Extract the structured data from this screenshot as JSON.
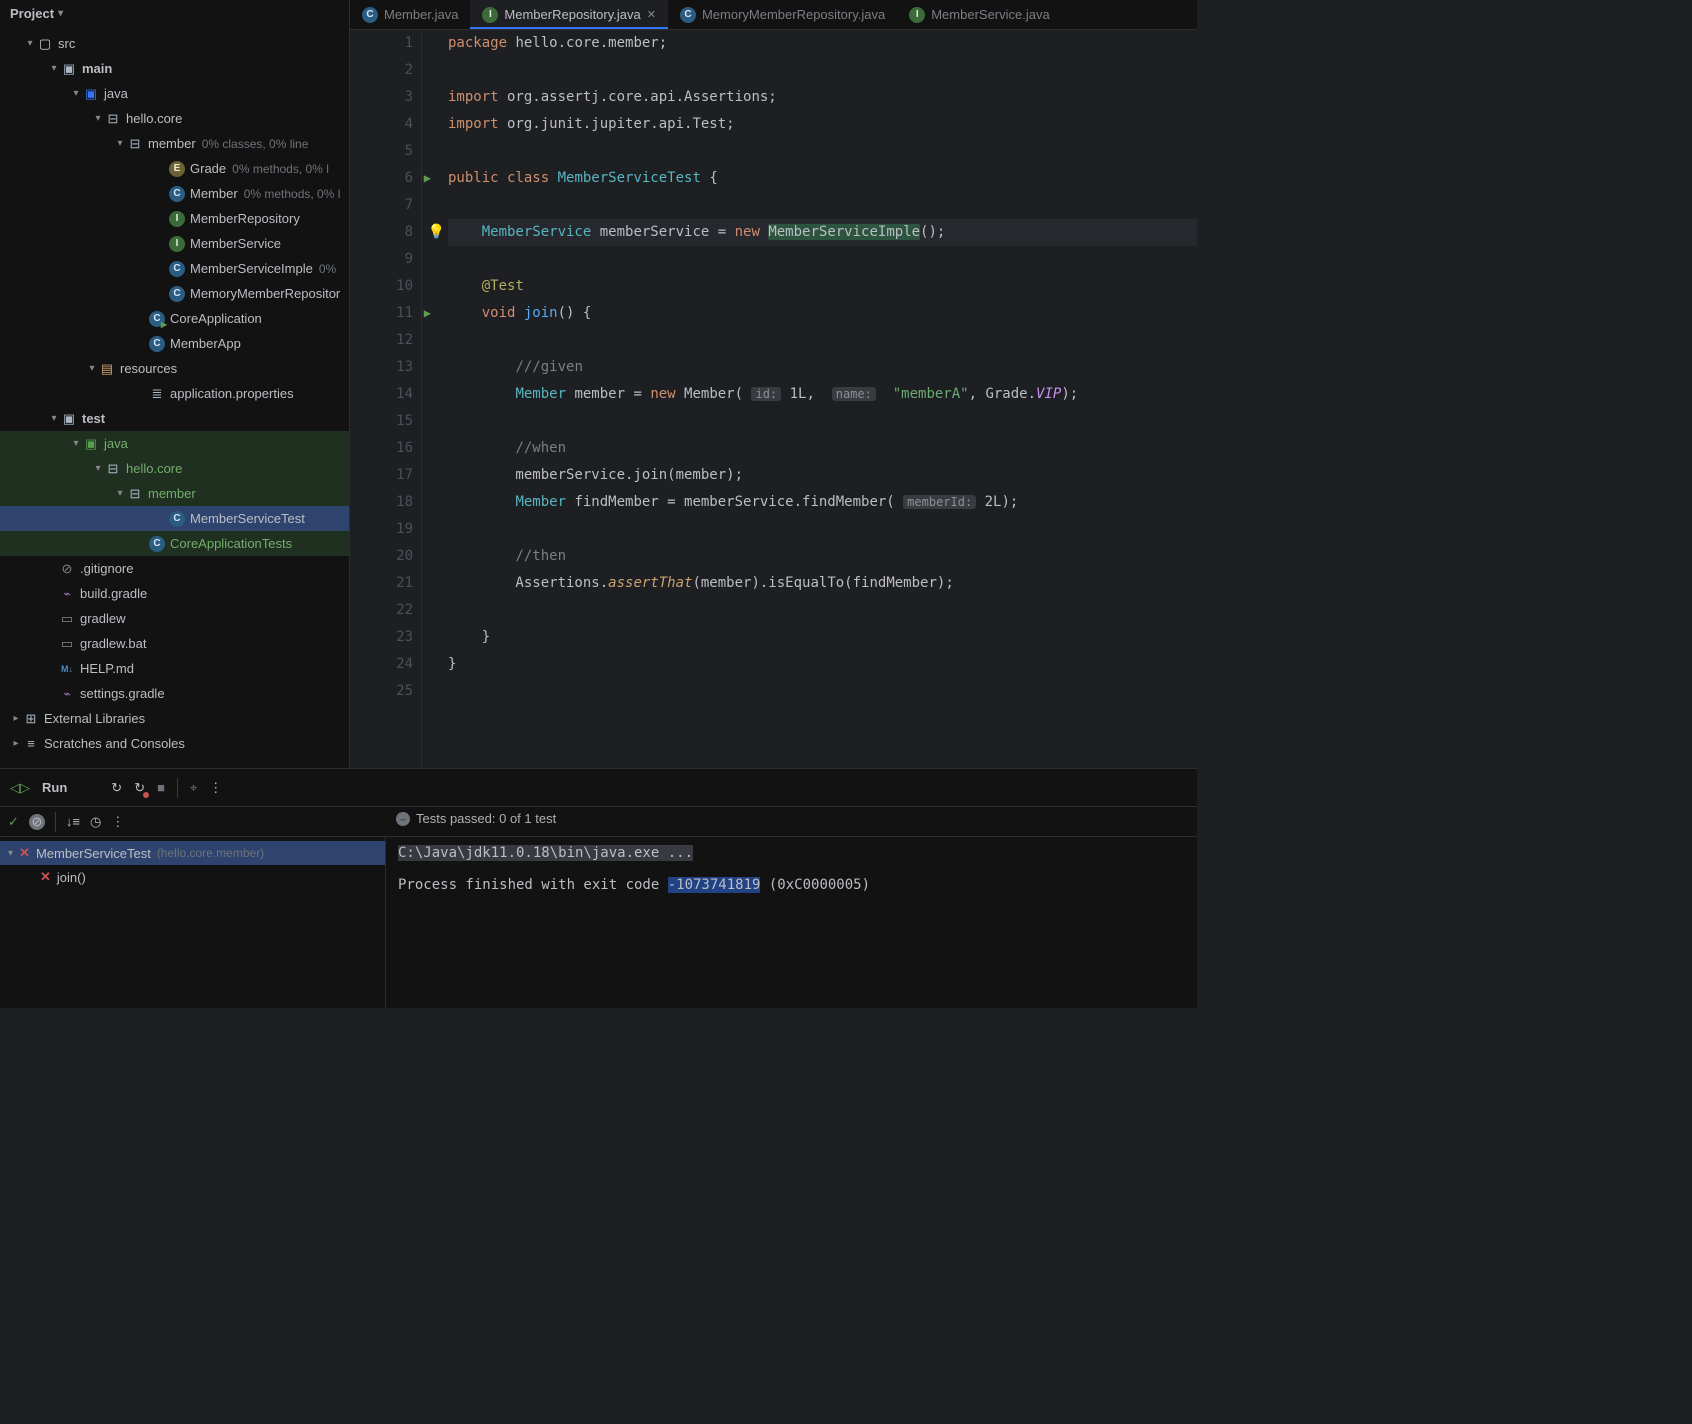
{
  "project": {
    "header": "Project",
    "tree": [
      {
        "indent": 24,
        "arrow": "▾",
        "iconType": "folder",
        "label": "src",
        "name": "folder-src"
      },
      {
        "indent": 48,
        "arrow": "▾",
        "iconType": "module",
        "label": "main",
        "bold": true,
        "name": "folder-main"
      },
      {
        "indent": 70,
        "arrow": "▾",
        "iconType": "folder-blue",
        "label": "java",
        "name": "folder-java-main"
      },
      {
        "indent": 92,
        "arrow": "▾",
        "iconType": "package",
        "label": "hello.core",
        "name": "package-hello-core-main"
      },
      {
        "indent": 114,
        "arrow": "▾",
        "iconType": "package",
        "label": "member",
        "hint": "0% classes, 0% line",
        "name": "package-member-main"
      },
      {
        "indent": 156,
        "arrow": "",
        "iconType": "enum",
        "label": "Grade",
        "hint": "0% methods, 0% l",
        "name": "file-grade"
      },
      {
        "indent": 156,
        "arrow": "",
        "iconType": "class",
        "label": "Member",
        "hint": "0% methods, 0% l",
        "name": "file-member"
      },
      {
        "indent": 156,
        "arrow": "",
        "iconType": "interface",
        "label": "MemberRepository",
        "name": "file-member-repository"
      },
      {
        "indent": 156,
        "arrow": "",
        "iconType": "interface",
        "label": "MemberService",
        "name": "file-member-service"
      },
      {
        "indent": 156,
        "arrow": "",
        "iconType": "class",
        "label": "MemberServiceImple",
        "hint": "0%",
        "name": "file-member-service-imple"
      },
      {
        "indent": 156,
        "arrow": "",
        "iconType": "class",
        "label": "MemoryMemberRepositor",
        "name": "file-memory-member-repository"
      },
      {
        "indent": 136,
        "arrow": "",
        "iconType": "class-run",
        "label": "CoreApplication",
        "name": "file-core-application"
      },
      {
        "indent": 136,
        "arrow": "",
        "iconType": "class",
        "label": "MemberApp",
        "name": "file-member-app"
      },
      {
        "indent": 86,
        "arrow": "▾",
        "iconType": "resources",
        "label": "resources",
        "name": "folder-resources"
      },
      {
        "indent": 136,
        "arrow": "",
        "iconType": "props",
        "label": "application.properties",
        "name": "file-application-properties"
      },
      {
        "indent": 48,
        "arrow": "▾",
        "iconType": "module",
        "label": "test",
        "bold": true,
        "name": "folder-test"
      },
      {
        "indent": 70,
        "arrow": "▾",
        "iconType": "folder-green",
        "label": "java",
        "green": true,
        "name": "folder-java-test"
      },
      {
        "indent": 92,
        "arrow": "▾",
        "iconType": "package",
        "label": "hello.core",
        "green": true,
        "name": "package-hello-core-test"
      },
      {
        "indent": 114,
        "arrow": "▾",
        "iconType": "package",
        "label": "member",
        "green": true,
        "name": "package-member-test"
      },
      {
        "indent": 156,
        "arrow": "",
        "iconType": "class",
        "label": "MemberServiceTest",
        "selected": true,
        "name": "file-member-service-test"
      },
      {
        "indent": 136,
        "arrow": "",
        "iconType": "class",
        "label": "CoreApplicationTests",
        "green": true,
        "name": "file-core-application-tests"
      },
      {
        "indent": 46,
        "arrow": "",
        "iconType": "gitignore",
        "label": ".gitignore",
        "name": "file-gitignore"
      },
      {
        "indent": 46,
        "arrow": "",
        "iconType": "gradle",
        "label": "build.gradle",
        "name": "file-build-gradle"
      },
      {
        "indent": 46,
        "arrow": "",
        "iconType": "sh",
        "label": "gradlew",
        "name": "file-gradlew"
      },
      {
        "indent": 46,
        "arrow": "",
        "iconType": "sh",
        "label": "gradlew.bat",
        "name": "file-gradlew-bat"
      },
      {
        "indent": 46,
        "arrow": "",
        "iconType": "md",
        "label": "HELP.md",
        "name": "file-help-md"
      },
      {
        "indent": 46,
        "arrow": "",
        "iconType": "gradle",
        "label": "settings.gradle",
        "name": "file-settings-gradle"
      },
      {
        "indent": 10,
        "arrow": "▸",
        "iconType": "lib",
        "label": "External Libraries",
        "name": "external-libraries"
      },
      {
        "indent": 10,
        "arrow": "▸",
        "iconType": "scratch",
        "label": "Scratches and Consoles",
        "name": "scratches-and-consoles"
      }
    ]
  },
  "tabs": [
    {
      "icon": "class",
      "label": "Member.java",
      "active": false,
      "name": "tab-member"
    },
    {
      "icon": "interface",
      "label": "MemberRepository.java",
      "active": true,
      "name": "tab-member-repository"
    },
    {
      "icon": "class",
      "label": "MemoryMemberRepository.java",
      "active": false,
      "name": "tab-memory-member-repository"
    },
    {
      "icon": "interface",
      "label": "MemberService.java",
      "active": false,
      "name": "tab-member-service"
    }
  ],
  "editor": {
    "lines": 25,
    "bulbLine": 8,
    "runMarks": [
      6,
      11
    ],
    "activeLine": 8
  },
  "code": {
    "l1": {
      "a": "package",
      "b": " hello.core.member;"
    },
    "l3": {
      "a": "import",
      "b": " org.assertj.core.api.Assertions;"
    },
    "l4": {
      "a": "import",
      "b": " org.junit.jupiter.api.Test;"
    },
    "l6": {
      "a": "public class",
      "b": " MemberServiceTest ",
      "c": "{"
    },
    "l8": {
      "a": "MemberService",
      "b": " memberService = ",
      "c": "new",
      "d": " ",
      "e": "MemberServiceImple",
      "f": "();"
    },
    "l10": {
      "a": "@Test"
    },
    "l11": {
      "a": "void",
      "b": " ",
      "c": "join",
      "d": "() {"
    },
    "l13": {
      "a": "///given"
    },
    "l14": {
      "a": "Member",
      "b": " member = ",
      "c": "new",
      "d": " Member( ",
      "h1": "id:",
      "e": " 1L,  ",
      "h2": "name:",
      "f": " \"memberA\"",
      "g": ", Grade.",
      "h": "VIP",
      "i": ");"
    },
    "l16": {
      "a": "//when"
    },
    "l17": {
      "a": "memberService.join(member);"
    },
    "l18": {
      "a": "Member",
      "b": " findMember = memberService.findMember( ",
      "h1": "memberId:",
      "c": " 2L);"
    },
    "l20": {
      "a": "//then"
    },
    "l21": {
      "a": "Assertions.",
      "b": "assertThat",
      "c": "(member).isEqualTo(findMember);"
    },
    "l23": {
      "a": "}"
    },
    "l24": {
      "a": "}"
    }
  },
  "run": {
    "label": "Run",
    "testStatus": "Tests passed: 0 of 1 test",
    "rootTest": "MemberServiceTest",
    "rootPkg": "(hello.core.member)",
    "childTest": "join()",
    "consoleCmd": "C:\\Java\\jdk11.0.18\\bin\\java.exe ...",
    "consoleL2a": "Process finished with exit code ",
    "consoleL2b": "-1073741819",
    "consoleL2c": " (0xC0000005)"
  }
}
